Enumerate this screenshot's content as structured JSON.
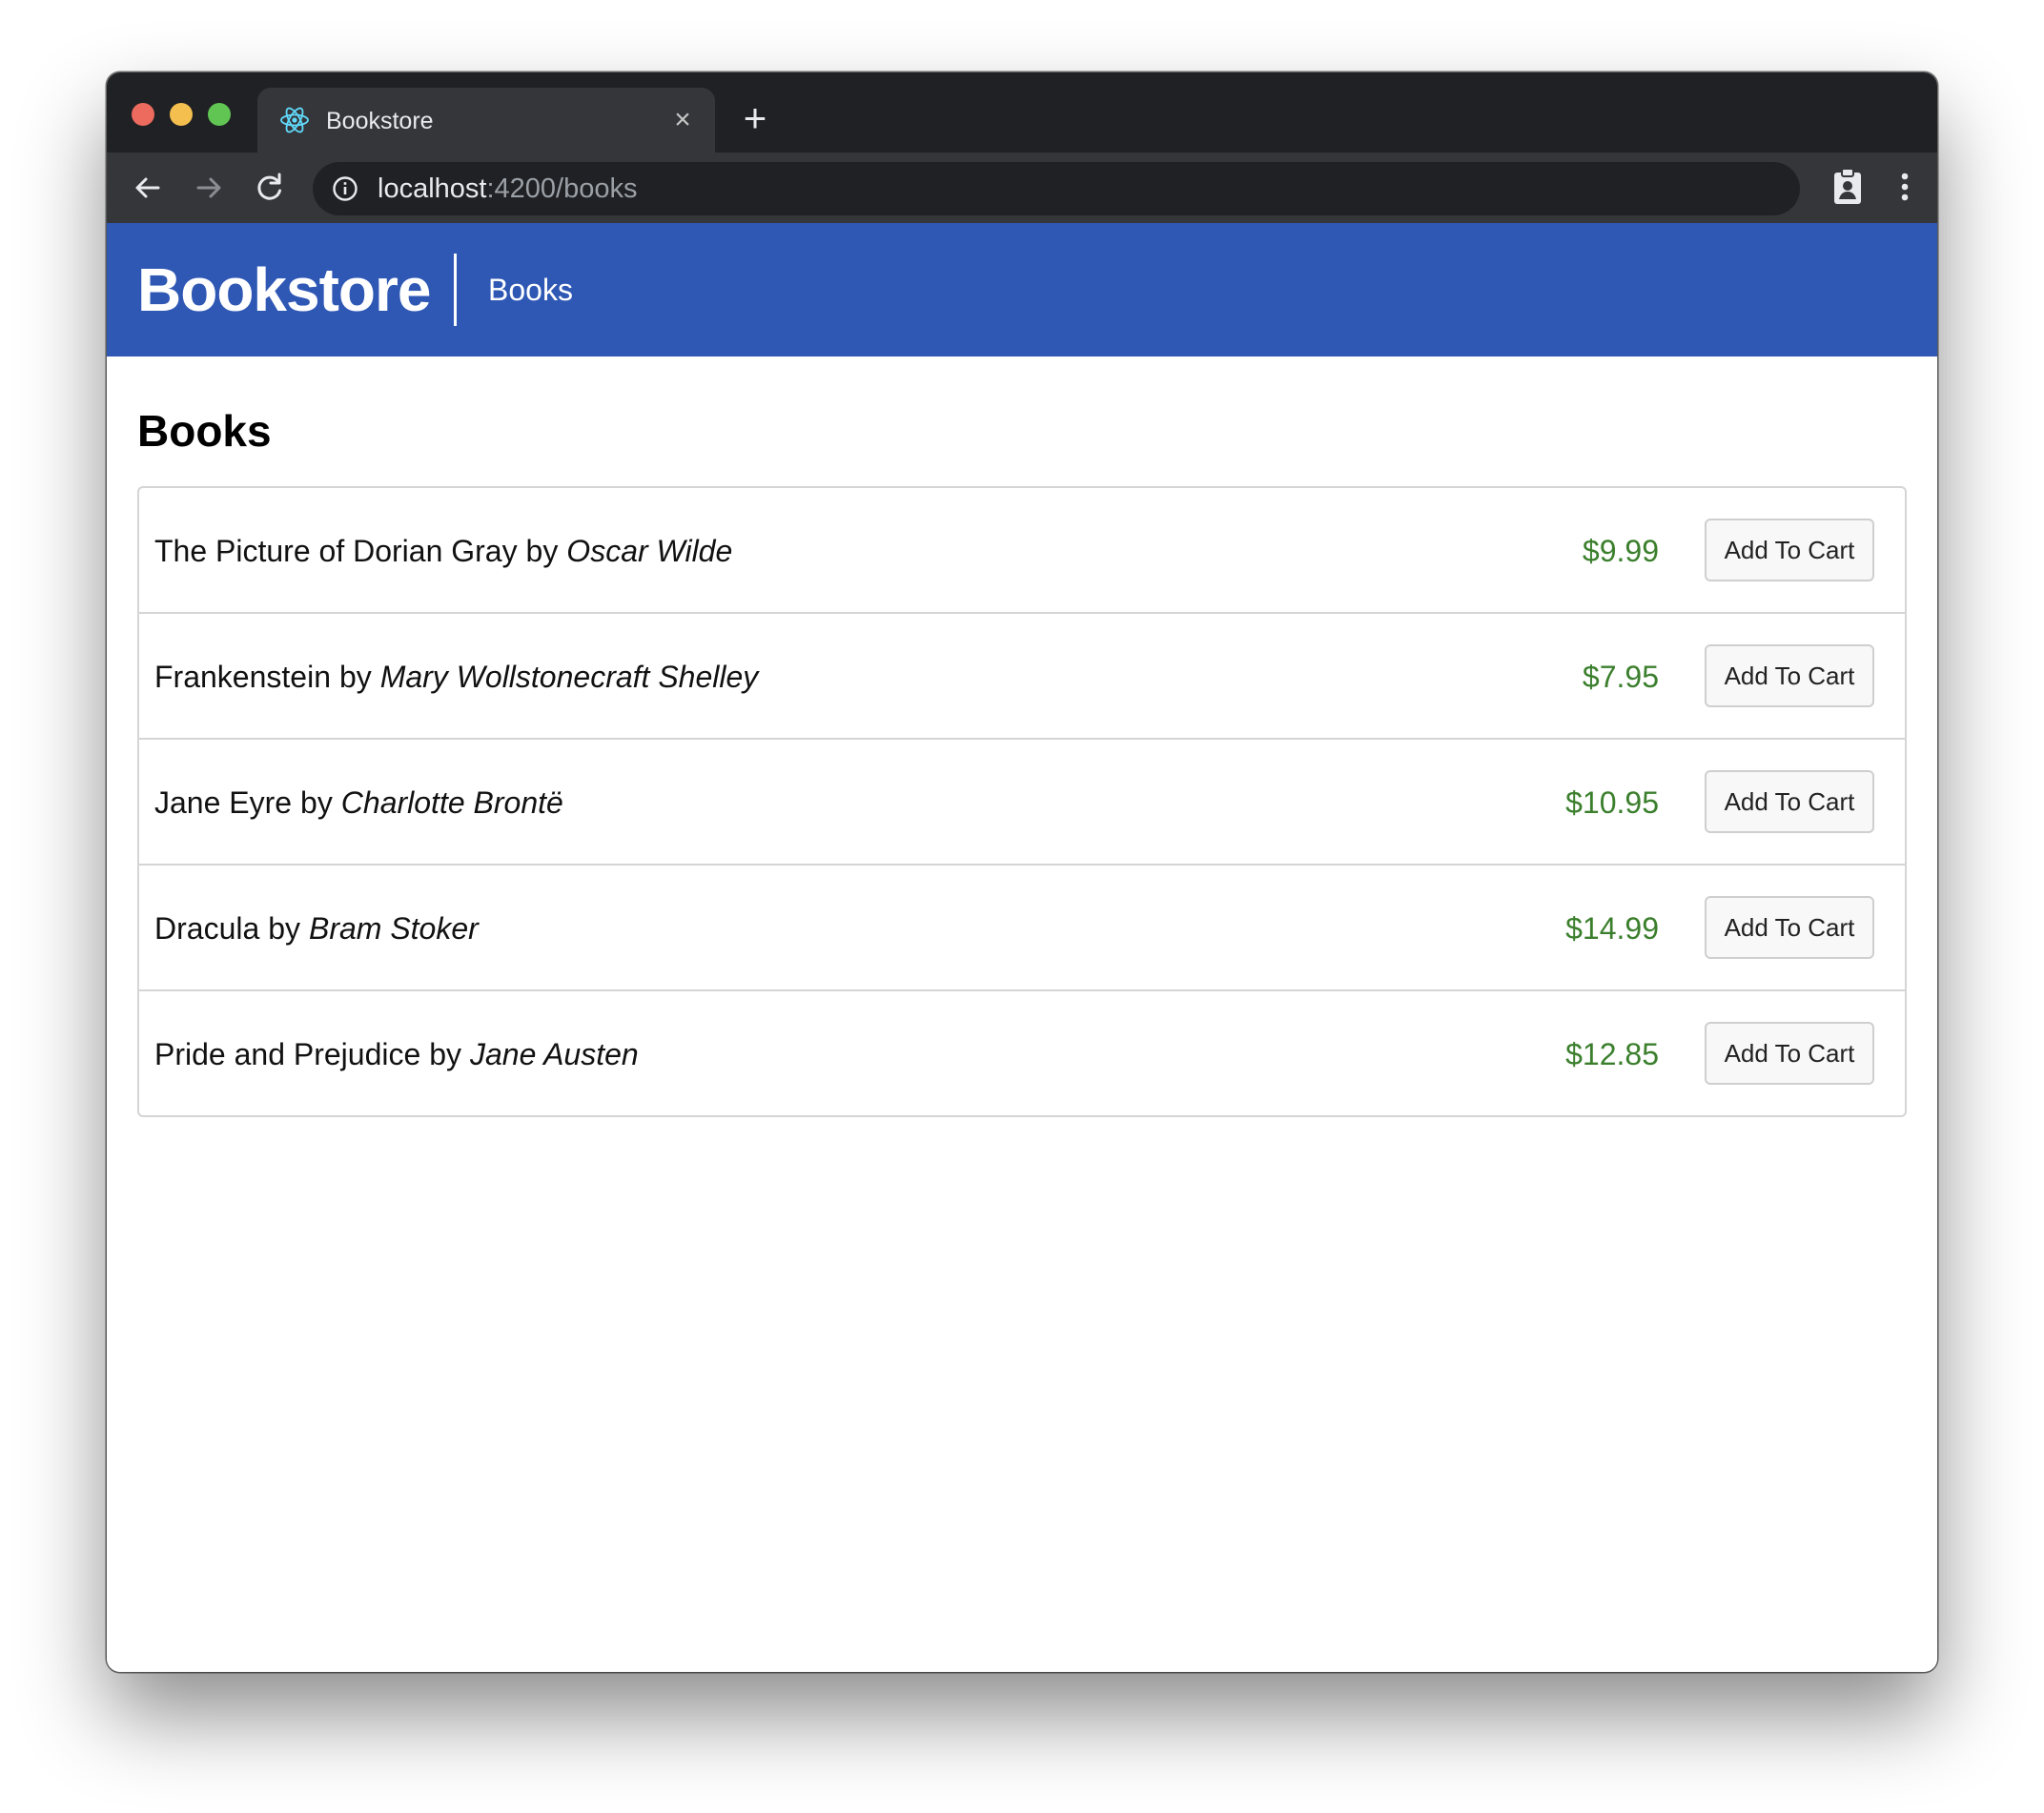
{
  "browser": {
    "tab_title": "Bookstore",
    "tab_close": "×",
    "new_tab": "+",
    "url_host": "localhost",
    "url_rest": ":4200/books",
    "tab_icon": "react-atom-icon",
    "nav_icons": [
      "back-arrow-icon",
      "forward-arrow-icon",
      "reload-icon"
    ],
    "toolbar_icons": [
      "clipboard-profile-icon",
      "more-vertical-icon"
    ]
  },
  "navbar": {
    "brand": "Bookstore",
    "link": "Books",
    "background": "#2f58b5"
  },
  "main": {
    "heading": "Books",
    "by_word": "by",
    "books": [
      {
        "title": "The Picture of Dorian Gray",
        "author": "Oscar Wilde",
        "price": "$9.99",
        "button": "Add To Cart"
      },
      {
        "title": "Frankenstein",
        "author": "Mary Wollstonecraft Shelley",
        "price": "$7.95",
        "button": "Add To Cart"
      },
      {
        "title": "Jane Eyre",
        "author": "Charlotte Brontë",
        "price": "$10.95",
        "button": "Add To Cart"
      },
      {
        "title": "Dracula",
        "author": "Bram Stoker",
        "price": "$14.99",
        "button": "Add To Cart"
      },
      {
        "title": "Pride and Prejudice",
        "author": "Jane Austen",
        "price": "$12.85",
        "button": "Add To Cart"
      }
    ],
    "price_color": "#3b7f2d"
  }
}
